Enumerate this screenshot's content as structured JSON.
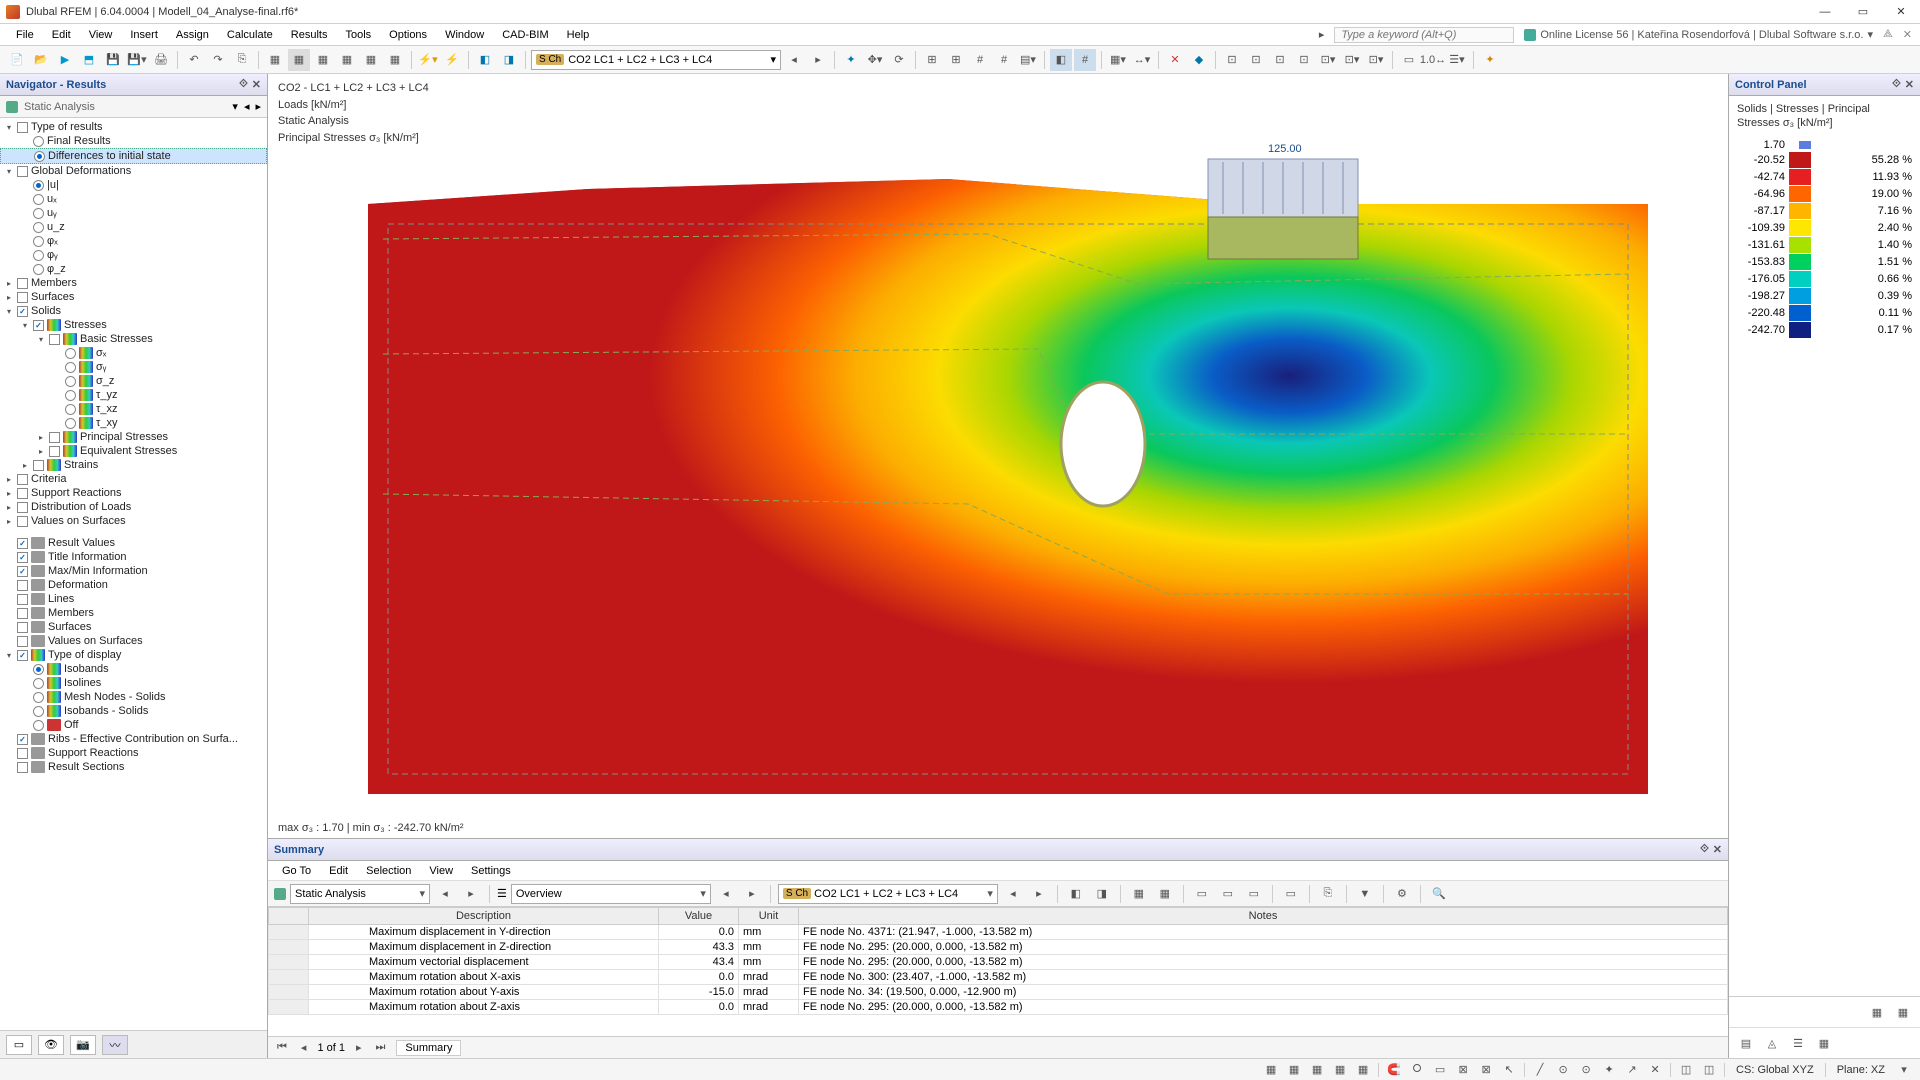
{
  "title": "Dlubal RFEM | 6.04.0004 | Modell_04_Analyse-final.rf6*",
  "menu": [
    "File",
    "Edit",
    "View",
    "Insert",
    "Assign",
    "Calculate",
    "Results",
    "Tools",
    "Options",
    "Window",
    "CAD-BIM",
    "Help"
  ],
  "search_placeholder": "Type a keyword (Alt+Q)",
  "license": "Online License 56 | Kateřina Rosendorfová | Dlubal Software s.r.o.",
  "combo_load": "CO2   LC1 + LC2 + LC3 + LC4",
  "sch_badge": "S Ch",
  "navigator": {
    "title": "Navigator - Results",
    "subtitle": "Static Analysis",
    "groups": [
      {
        "label": "Type of results",
        "children": [
          {
            "type": "radio",
            "label": "Final Results",
            "checked": false
          },
          {
            "type": "radio",
            "label": "Differences to initial state",
            "checked": true,
            "selected": true
          }
        ]
      },
      {
        "label": "Global Deformations",
        "children": [
          {
            "type": "radio",
            "label": "|u|",
            "checked": true
          },
          {
            "type": "radio",
            "label": "uₓ"
          },
          {
            "type": "radio",
            "label": "uᵧ"
          },
          {
            "type": "radio",
            "label": "u_z"
          },
          {
            "type": "radio",
            "label": "φₓ"
          },
          {
            "type": "radio",
            "label": "φᵧ"
          },
          {
            "type": "radio",
            "label": "φ_z"
          }
        ]
      },
      {
        "label": "Members",
        "expandable": true
      },
      {
        "label": "Surfaces",
        "expandable": true
      },
      {
        "label": "Solids",
        "checked": true,
        "expanded": true,
        "children": [
          {
            "label": "Stresses",
            "checked": true,
            "expanded": true,
            "children": [
              {
                "label": "Basic Stresses",
                "expanded": true,
                "children": [
                  {
                    "type": "radio",
                    "label": "σₓ",
                    "icon": "rainbow"
                  },
                  {
                    "type": "radio",
                    "label": "σᵧ",
                    "icon": "rainbow"
                  },
                  {
                    "type": "radio",
                    "label": "σ_z",
                    "icon": "rainbow"
                  },
                  {
                    "type": "radio",
                    "label": "τ_yz",
                    "icon": "rainbow"
                  },
                  {
                    "type": "radio",
                    "label": "τ_xz",
                    "icon": "rainbow"
                  },
                  {
                    "type": "radio",
                    "label": "τ_xy",
                    "icon": "rainbow"
                  }
                ]
              },
              {
                "label": "Principal Stresses",
                "expandable": true
              },
              {
                "label": "Equivalent Stresses",
                "expandable": true
              }
            ]
          },
          {
            "label": "Strains",
            "expandable": true
          }
        ]
      },
      {
        "label": "Criteria",
        "expandable": true
      },
      {
        "label": "Support Reactions",
        "expandable": true
      },
      {
        "label": "Distribution of Loads",
        "expandable": true
      },
      {
        "label": "Values on Surfaces",
        "expandable": true
      }
    ],
    "lower": [
      {
        "label": "Result Values",
        "checked": true
      },
      {
        "label": "Title Information",
        "checked": true
      },
      {
        "label": "Max/Min Information",
        "checked": true
      },
      {
        "label": "Deformation"
      },
      {
        "label": "Lines"
      },
      {
        "label": "Members"
      },
      {
        "label": "Surfaces"
      },
      {
        "label": "Values on Surfaces"
      },
      {
        "label": "Type of display",
        "checked": true,
        "expanded": true,
        "children": [
          {
            "type": "radio",
            "label": "Isobands",
            "checked": true,
            "icon": "rainbow"
          },
          {
            "type": "radio",
            "label": "Isolines",
            "icon": "rainbow"
          },
          {
            "type": "radio",
            "label": "Mesh Nodes - Solids",
            "icon": "rainbow"
          },
          {
            "type": "radio",
            "label": "Isobands - Solids",
            "icon": "rainbow"
          },
          {
            "type": "radio",
            "label": "Off",
            "icon": "red"
          }
        ]
      },
      {
        "label": "Ribs - Effective Contribution on Surfa...",
        "checked": true
      },
      {
        "label": "Support Reactions"
      },
      {
        "label": "Result Sections"
      }
    ]
  },
  "viewport": {
    "line1": "CO2 - LC1 + LC2 + LC3 + LC4",
    "line2": "Loads [kN/m²]",
    "line3": "Static Analysis",
    "line4": "Principal Stresses σ₃ [kN/m²]",
    "load_value": "125.00",
    "footer": "max σ₃ : 1.70 | min σ₃ : -242.70 kN/m²"
  },
  "summary": {
    "title": "Summary",
    "menu": [
      "Go To",
      "Edit",
      "Selection",
      "View",
      "Settings"
    ],
    "combo1": "Static Analysis",
    "combo2": "Overview",
    "combo3": "CO2   LC1 + LC2 + LC3 + LC4",
    "headers": [
      "Description",
      "Value",
      "Unit",
      "Notes"
    ],
    "rows": [
      [
        "Maximum displacement in Y-direction",
        "0.0",
        "mm",
        "FE node No. 4371: (21.947, -1.000, -13.582 m)"
      ],
      [
        "Maximum displacement in Z-direction",
        "43.3",
        "mm",
        "FE node No. 295: (20.000, 0.000, -13.582 m)"
      ],
      [
        "Maximum vectorial displacement",
        "43.4",
        "mm",
        "FE node No. 295: (20.000, 0.000, -13.582 m)"
      ],
      [
        "Maximum rotation about X-axis",
        "0.0",
        "mrad",
        "FE node No. 300: (23.407, -1.000, -13.582 m)"
      ],
      [
        "Maximum rotation about Y-axis",
        "-15.0",
        "mrad",
        "FE node No. 34: (19.500, 0.000, -12.900 m)"
      ],
      [
        "Maximum rotation about Z-axis",
        "0.0",
        "mrad",
        "FE node No. 295: (20.000, 0.000, -13.582 m)"
      ]
    ],
    "pager": "1 of 1",
    "tab": "Summary"
  },
  "control_panel": {
    "title": "Control Panel",
    "subtitle": "Solids | Stresses | Principal Stresses σ₃ [kN/m²]",
    "legend": [
      {
        "v": "1.70",
        "c": "#5b7de0",
        "pct": ""
      },
      {
        "v": "-20.52",
        "c": "#c01818",
        "pct": "55.28 %"
      },
      {
        "v": "-42.74",
        "c": "#e62020",
        "pct": "11.93 %"
      },
      {
        "v": "-64.96",
        "c": "#ff6600",
        "pct": "19.00 %"
      },
      {
        "v": "-87.17",
        "c": "#ffb400",
        "pct": "7.16 %"
      },
      {
        "v": "-109.39",
        "c": "#ffe600",
        "pct": "2.40 %"
      },
      {
        "v": "-131.61",
        "c": "#a8e000",
        "pct": "1.40 %"
      },
      {
        "v": "-153.83",
        "c": "#00d060",
        "pct": "1.51 %"
      },
      {
        "v": "-176.05",
        "c": "#00d0c0",
        "pct": "0.66 %"
      },
      {
        "v": "-198.27",
        "c": "#00a0e0",
        "pct": "0.39 %"
      },
      {
        "v": "-220.48",
        "c": "#0060d0",
        "pct": "0.11 %"
      },
      {
        "v": "-242.70",
        "c": "#102080",
        "pct": "0.17 %"
      }
    ]
  },
  "status": {
    "cs": "CS: Global XYZ",
    "plane": "Plane: XZ"
  }
}
